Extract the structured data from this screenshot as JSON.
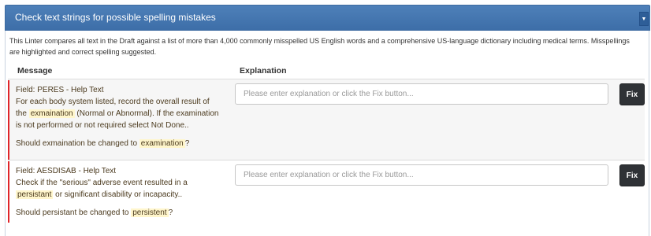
{
  "panel": {
    "title": "Check text strings for possible spelling mistakes",
    "collapse_icon": "caret-down-icon",
    "description": "This Linter compares all text in the Draft against a list of more than 4,000 commonly misspelled US English words and a comprehensive US-language dictionary including medical terms. Misspellings are highlighted and correct spelling suggested."
  },
  "table": {
    "columns": [
      "Message",
      "Explanation"
    ],
    "rows": [
      {
        "field": "Field: PERES - Help Text",
        "text_before": "For each body system listed, record the overall result of the ",
        "highlight": "exmaination",
        "text_after": " (Normal or Abnormal). If the examination is not performed or not required select Not Done..",
        "question_prefix": "Should exmaination be changed to ",
        "suggestion": "examination",
        "question_suffix": "?",
        "explanation_placeholder": "Please enter explanation or click the Fix button...",
        "fix_label": "Fix"
      },
      {
        "field": "Field: AESDISAB - Help Text",
        "text_before": "Check if the \"serious\" adverse event resulted in a ",
        "highlight": "persistant",
        "text_after": " or significant disability or incapacity..",
        "question_prefix": "Should persistant be changed to ",
        "suggestion": "persistent",
        "question_suffix": "?",
        "explanation_placeholder": "Please enter explanation or click the Fix button...",
        "fix_label": "Fix"
      }
    ]
  },
  "colors": {
    "header_blue": "#4a7bb5",
    "error_bar": "#e0252a",
    "highlight": "#fff6cc",
    "fix_button": "#2f3236"
  }
}
